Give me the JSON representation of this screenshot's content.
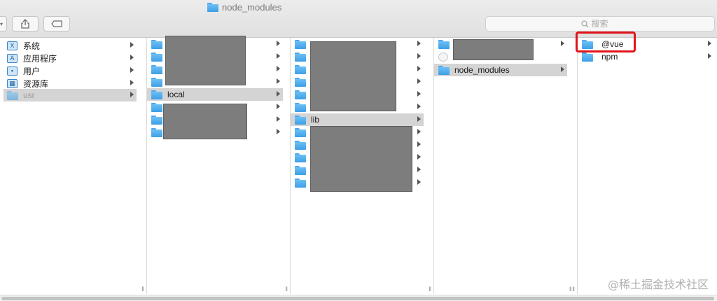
{
  "window": {
    "title": "node_modules"
  },
  "search": {
    "placeholder": "搜索"
  },
  "sidebar": {
    "items": [
      {
        "label": "系统",
        "icon": "app-icon"
      },
      {
        "label": "应用程序",
        "icon": "app-icon"
      },
      {
        "label": "用户",
        "icon": "user-icon"
      },
      {
        "label": "资源库",
        "icon": "library-icon"
      },
      {
        "label": "usr",
        "icon": "folder-icon"
      }
    ]
  },
  "columns": {
    "col2_selected": "local",
    "col3_selected": "lib",
    "col4_selected": "node_modules",
    "col5_items": [
      "@vue",
      "npm"
    ]
  },
  "watermark": "@稀土掘金技术社区"
}
